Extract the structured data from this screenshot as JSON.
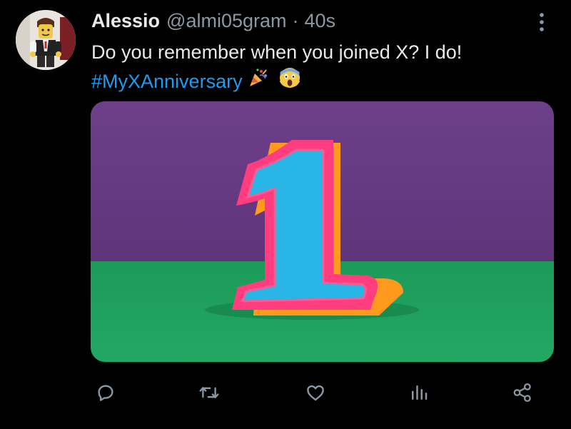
{
  "tweet": {
    "author": {
      "name": "Alessio",
      "handle": "@almi05gram",
      "avatar_icon": "lego-minifigure-avatar"
    },
    "separator": "·",
    "timestamp": "40s",
    "text_line1": "Do you remember when you joined X? I do!",
    "hashtag": "#MyXAnniversary",
    "emojis": [
      "party-popper-emoji",
      "screaming-face-emoji"
    ],
    "media": {
      "description_icon": "number-one-anniversary-image",
      "colors": {
        "wall": "#6b3f86",
        "floor": "#1f9e5c",
        "digit_face": "#29b6e6",
        "digit_border": "#ff3d7f",
        "digit_shadow": "#ff9a1f"
      }
    }
  },
  "actions": [
    {
      "name": "reply",
      "icon": "reply-icon"
    },
    {
      "name": "repost",
      "icon": "repost-icon"
    },
    {
      "name": "like",
      "icon": "heart-icon"
    },
    {
      "name": "views",
      "icon": "views-icon"
    },
    {
      "name": "share",
      "icon": "share-icon"
    }
  ],
  "theme": {
    "background": "#000000",
    "text": "#e7e9ea",
    "secondary_text": "#8b98a5",
    "link": "#1d9bf0",
    "icon": "#8b98a5"
  }
}
